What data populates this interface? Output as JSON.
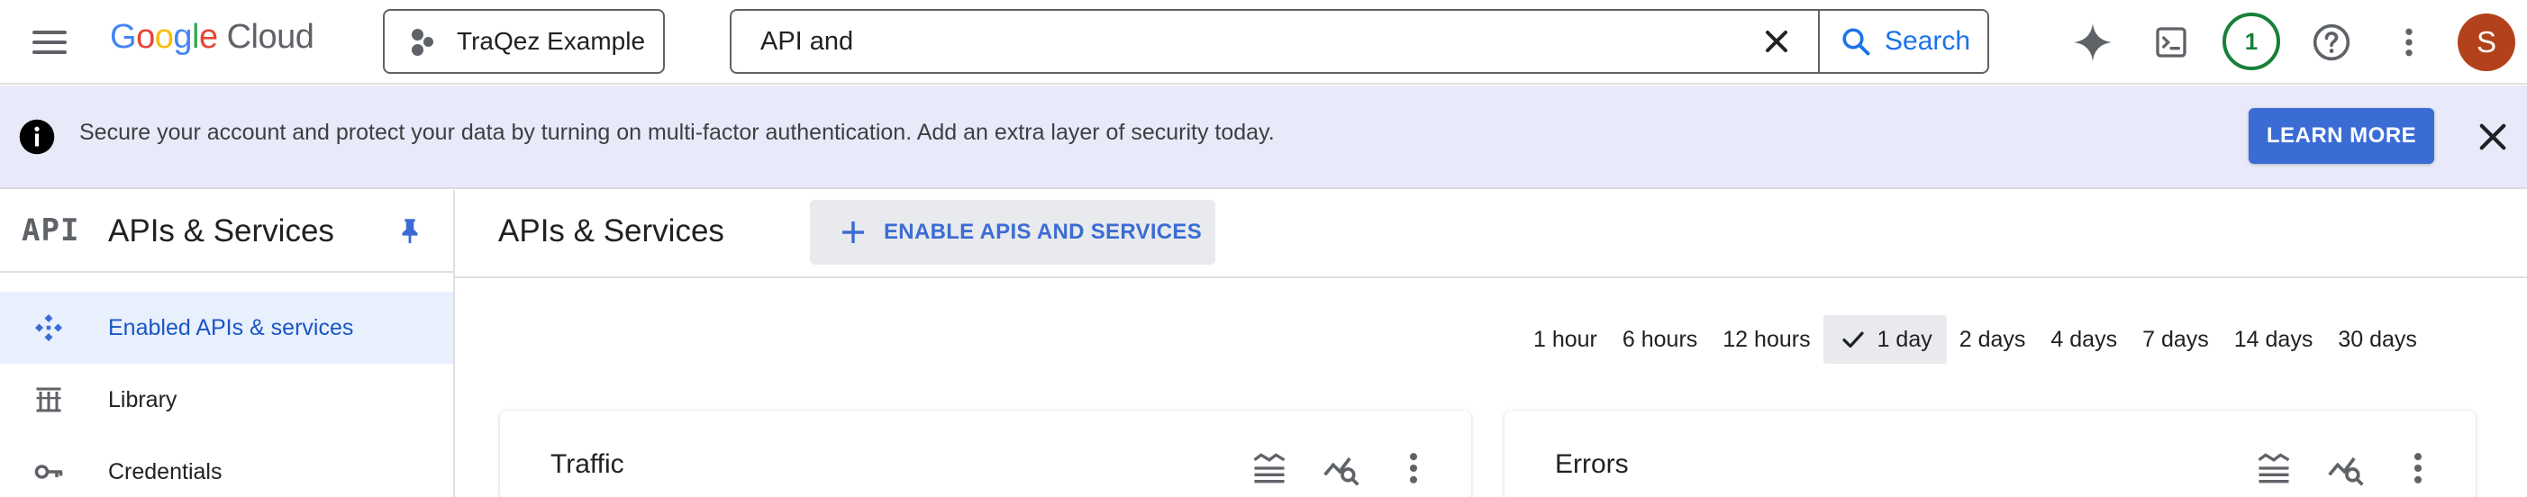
{
  "topbar": {
    "logo": {
      "letters": [
        "G",
        "o",
        "o",
        "g",
        "l",
        "e"
      ],
      "product": "Cloud"
    },
    "project": {
      "name": "TraQez Example"
    },
    "search": {
      "value": "API and",
      "button_label": "Search"
    },
    "notification_count": "1",
    "avatar_initial": "S",
    "icons": [
      "menu-icon",
      "gemini-sparkle-icon",
      "cloud-shell-icon",
      "help-icon",
      "more-vert-icon"
    ]
  },
  "banner": {
    "message": "Secure your account and protect your data by turning on multi-factor authentication. Add an extra layer of security today.",
    "learn_more": "LEARN MORE",
    "bg_color": "#e8eaf9",
    "button_color": "#3b6cd4"
  },
  "sidebar": {
    "logo_text": "API",
    "title": "APIs & Services",
    "items": [
      {
        "label": "Enabled APIs & services",
        "icon": "apis-icon",
        "active": true
      },
      {
        "label": "Library",
        "icon": "library-icon",
        "active": false
      },
      {
        "label": "Credentials",
        "icon": "key-icon",
        "active": false
      }
    ]
  },
  "main": {
    "title": "APIs & Services",
    "enable_button": "ENABLE APIS AND SERVICES",
    "time_ranges": [
      "1 hour",
      "6 hours",
      "12 hours",
      "1 day",
      "2 days",
      "4 days",
      "7 days",
      "14 days",
      "30 days"
    ],
    "selected_range": "1 day",
    "cards": [
      {
        "title": "Traffic"
      },
      {
        "title": "Errors"
      }
    ]
  }
}
